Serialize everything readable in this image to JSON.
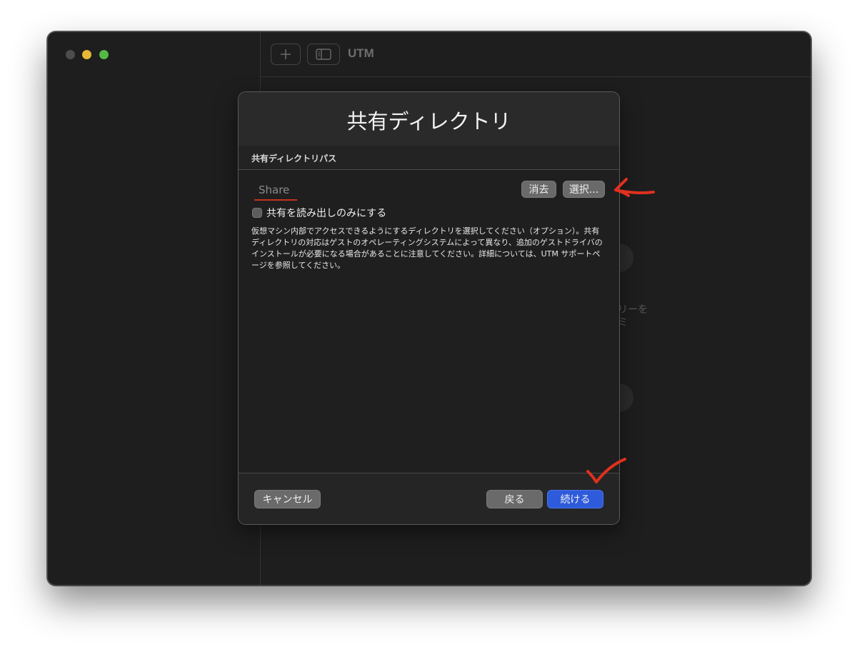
{
  "window": {
    "app_title": "UTM",
    "toolbar": {
      "add_icon": "plus-icon",
      "sidebar_toggle_icon": "sidebar-icon"
    },
    "background_fragments": [
      "リーを",
      "ミ"
    ]
  },
  "dialog": {
    "title": "共有ディレクトリ",
    "section_label": "共有ディレクトリパス",
    "path_field": {
      "placeholder": "Share",
      "value": ""
    },
    "clear_button": "消去",
    "select_button": "選択...",
    "readonly_checkbox": {
      "label": "共有を読み出しのみにする",
      "checked": false
    },
    "description": "仮想マシン内部でアクセスできるようにするディレクトリを選択してください（オプション）。共有ディレクトリの対応はゲストのオペレーティングシステムによって異なり、追加のゲストドライバのインストールが必要になる場合があることに注意してください。詳細については、UTM サポートページを参照してください。",
    "cancel_button": "キャンセル",
    "back_button": "戻る",
    "continue_button": "続ける"
  },
  "colors": {
    "accent_blue": "#2e5bdb",
    "annotation_red": "#e0301e"
  }
}
